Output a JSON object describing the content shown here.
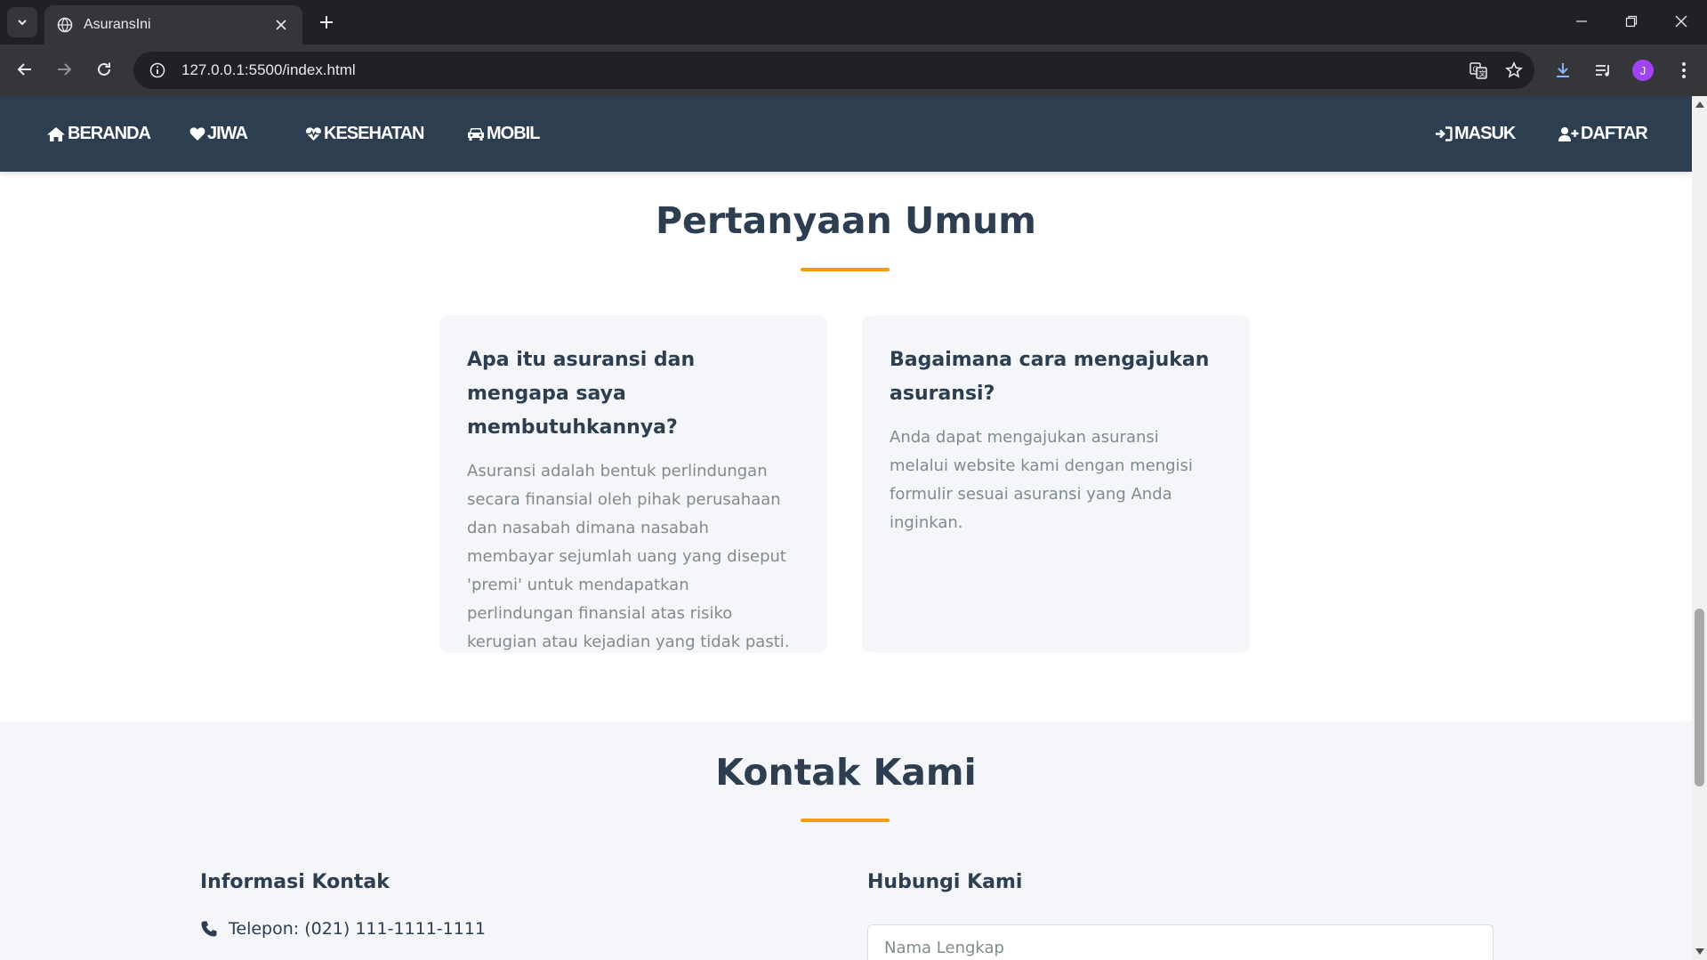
{
  "browser": {
    "tab_title": "AsuransIni",
    "url": "127.0.0.1:5500/index.html",
    "profile_initial": "J"
  },
  "nav": {
    "left": [
      {
        "label": "BERANDA",
        "icon": "home-icon"
      },
      {
        "label": "JIWA",
        "icon": "heart-icon"
      },
      {
        "label": "KESEHATAN",
        "icon": "heartbeat-icon"
      },
      {
        "label": "MOBIL",
        "icon": "car-icon"
      }
    ],
    "right": [
      {
        "label": "MASUK",
        "icon": "sign-in-icon"
      },
      {
        "label": "DAFTAR",
        "icon": "user-plus-icon"
      }
    ]
  },
  "faq": {
    "title": "Pertanyaan Umum",
    "items": [
      {
        "question": "Apa itu asuransi dan mengapa saya membutuhkannya?",
        "answer": "Asuransi adalah bentuk perlindungan secara finansial oleh pihak perusahaan dan nasabah dimana nasabah membayar sejumlah uang yang diseput 'premi' untuk mendapatkan perlindungan finansial atas risiko kerugian atau kejadian yang tidak pasti."
      },
      {
        "question": "Bagaimana cara mengajukan asuransi?",
        "answer": "Anda dapat mengajukan asuransi melalui website kami dengan mengisi formulir sesuai asuransi yang Anda inginkan."
      }
    ]
  },
  "contact": {
    "title": "Kontak Kami",
    "info_heading": "Informasi Kontak",
    "phone": "Telepon: (021) 111-1111-1111",
    "form_heading": "Hubungi Kami",
    "name_placeholder": "Nama Lengkap"
  },
  "colors": {
    "nav_bg": "#2c3e50",
    "accent": "#f39c12",
    "card_bg": "#f5f6fa"
  }
}
